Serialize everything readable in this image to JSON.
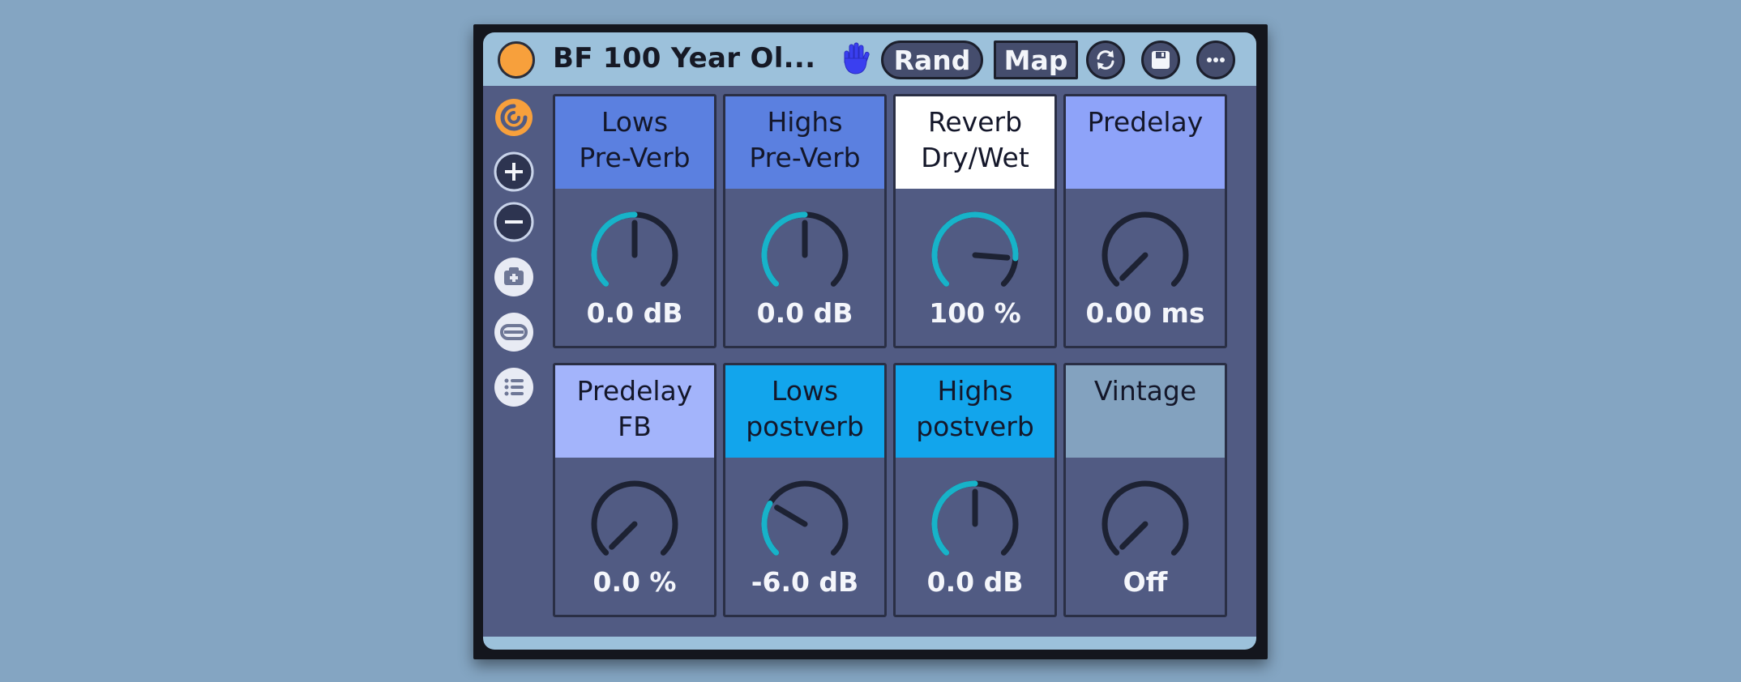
{
  "device": {
    "title": "BF 100 Year Ol...",
    "rand_label": "Rand",
    "map_label": "Map"
  },
  "colors": {
    "background": "#84a5c2",
    "rack_header": "#9cc1db",
    "rack_body": "#515b83",
    "power_orange": "#f7a03c",
    "knob_arc": "#17b3c9",
    "hand_icon": "#3a3ff0"
  },
  "sidebar": {
    "icons": [
      "chain-select-icon",
      "add-icon",
      "remove-icon",
      "snapshot-icon",
      "variation-icon",
      "list-icon"
    ]
  },
  "macros": [
    {
      "label_line1": "Lows",
      "label_line2": "Pre-Verb",
      "value": "0.0 dB",
      "level": 0.5,
      "label_bg": "#5b80e0"
    },
    {
      "label_line1": "Highs",
      "label_line2": "Pre-Verb",
      "value": "0.0 dB",
      "level": 0.5,
      "label_bg": "#5b80e0"
    },
    {
      "label_line1": "Reverb",
      "label_line2": "Dry/Wet",
      "value": "100 %",
      "level": 0.85,
      "label_bg": "#ffffff"
    },
    {
      "label_line1": "Predelay",
      "label_line2": "",
      "value": "0.00 ms",
      "level": 0.0,
      "label_bg": "#8ea3f9"
    },
    {
      "label_line1": "Predelay",
      "label_line2": "FB",
      "value": "0.0 %",
      "level": 0.0,
      "label_bg": "#a3b4fb"
    },
    {
      "label_line1": "Lows",
      "label_line2": "postverb",
      "value": "-6.0 dB",
      "level": 0.28,
      "label_bg": "#12a5ec"
    },
    {
      "label_line1": "Highs",
      "label_line2": "postverb",
      "value": "0.0 dB",
      "level": 0.5,
      "label_bg": "#12a5ec"
    },
    {
      "label_line1": "Vintage",
      "label_line2": "",
      "value": "Off",
      "level": 0.0,
      "label_bg": "#83a2bf"
    }
  ]
}
